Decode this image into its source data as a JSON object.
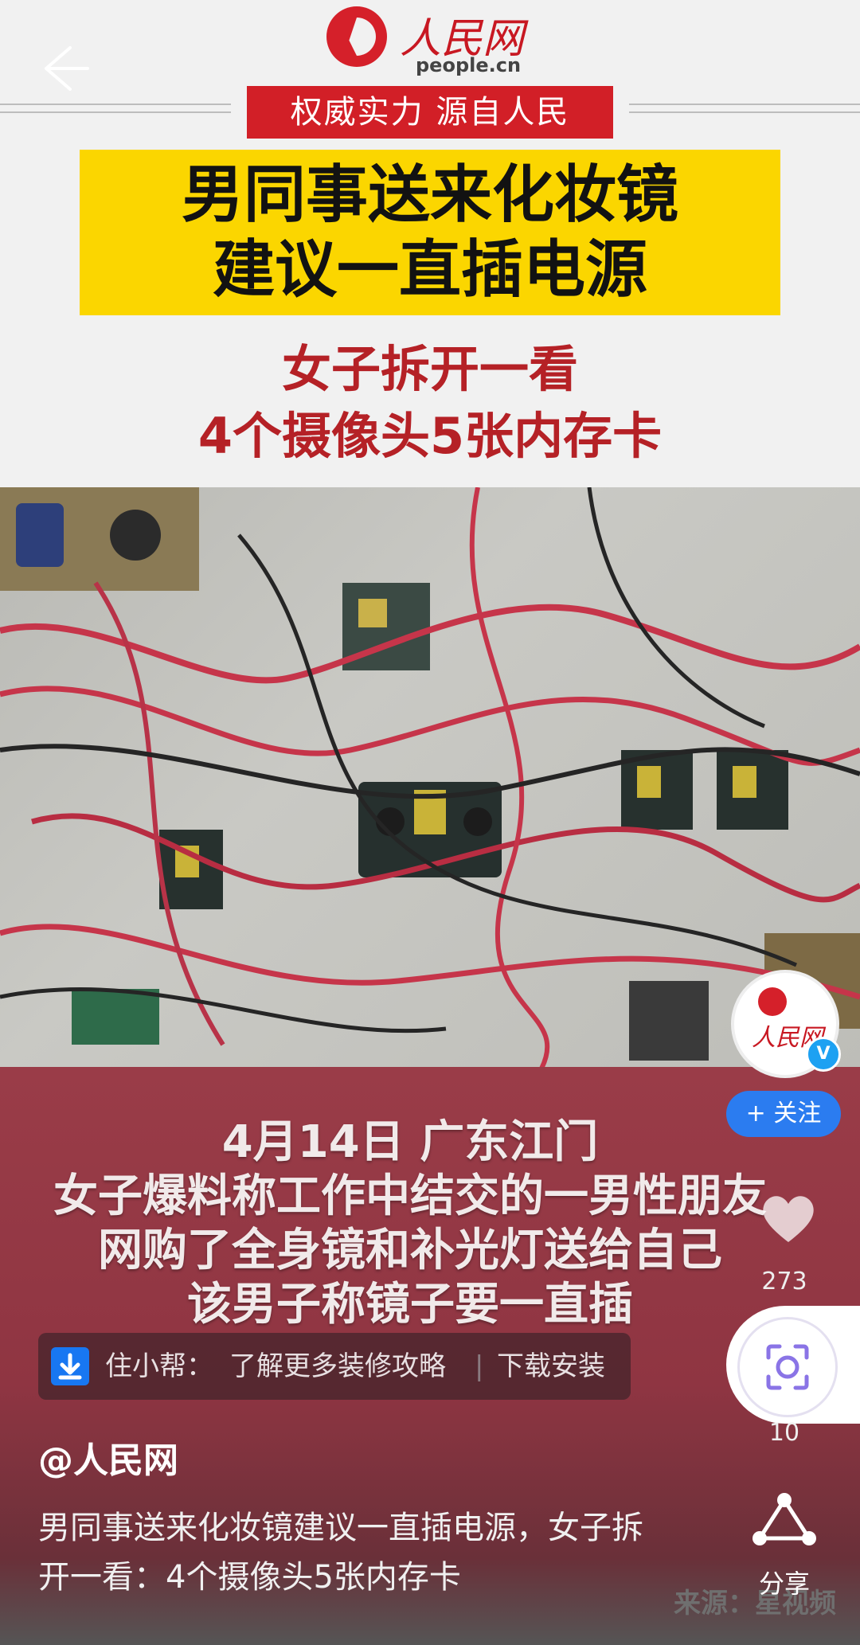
{
  "header": {
    "logo_name": "人民网",
    "logo_url": "people.cn",
    "slogan": "权威实力 源自人民"
  },
  "video": {
    "headline_lines": [
      "男同事送来化妆镜",
      "建议一直插电源"
    ],
    "subhead_lines": [
      "女子拆开一看",
      "4个摄像头5张内存卡"
    ],
    "caption_lines": [
      "4月14日 广东江门",
      "女子爆料称工作中结交的一男性朋友",
      "网购了全身镜和补光灯送给自己",
      "该男子称镜子要一直插"
    ],
    "watermark": "来源：星视频"
  },
  "ad": {
    "app": "住小帮：",
    "text": "了解更多装修攻略",
    "divider": "|",
    "action": "下载安装"
  },
  "post": {
    "author": "@人民网",
    "description": "男同事送来化妆镜建议一直插电源，女子拆开一看：4个摄像头5张内存卡"
  },
  "rail": {
    "avatar_text": "人民网",
    "verified": "V",
    "follow_label": "+ 关注",
    "like_count": "273",
    "comment_count": "10",
    "share_label": "分享"
  },
  "colors": {
    "brand_red": "#d21f27",
    "headline_yellow": "#fbd600",
    "follow_blue": "#2b7cf0"
  }
}
